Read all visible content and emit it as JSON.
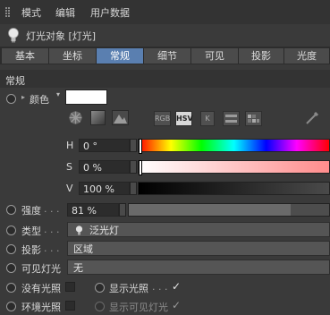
{
  "menu": [
    "模式",
    "编辑",
    "用户数据"
  ],
  "header": {
    "title": "灯光对象 [灯光]"
  },
  "tabs": [
    {
      "label": "基本"
    },
    {
      "label": "坐标"
    },
    {
      "label": "常规",
      "active": true
    },
    {
      "label": "细节"
    },
    {
      "label": "可见"
    },
    {
      "label": "投影"
    },
    {
      "label": "光度"
    }
  ],
  "section": {
    "title": "常规"
  },
  "color": {
    "label": "颜色",
    "swatch": "#ffffff"
  },
  "color_modes": [
    "RGB",
    "HSV",
    "K"
  ],
  "hsv": {
    "h": {
      "label": "H",
      "value": "0 °"
    },
    "s": {
      "label": "S",
      "value": "0 %"
    },
    "v": {
      "label": "V",
      "value": "100 %"
    }
  },
  "intensity": {
    "label": "强度",
    "value": "81 %",
    "fraction": 0.81
  },
  "type": {
    "label": "类型",
    "value": "泛光灯"
  },
  "shadow": {
    "label": "投影",
    "value": "区域"
  },
  "visible_light": {
    "label": "可见灯光",
    "value": "无"
  },
  "no_illum": {
    "label": "没有光照"
  },
  "show_illum": {
    "label": "显示光照",
    "checked": true
  },
  "ambient": {
    "label": "环境光照"
  },
  "show_visible": {
    "label": "显示可见灯光",
    "checked": true
  },
  "colors": {
    "accent": "#5a7fb0",
    "background": "#3a3a3a"
  }
}
